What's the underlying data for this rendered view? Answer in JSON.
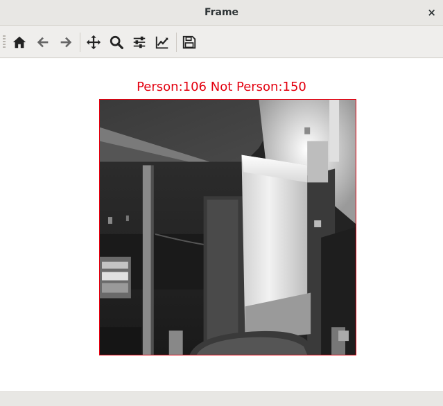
{
  "window": {
    "title": "Frame",
    "close_symbol": "×"
  },
  "toolbar": {
    "buttons": [
      {
        "name": "home-button",
        "icon": "home-icon"
      },
      {
        "name": "back-button",
        "icon": "arrow-left-icon"
      },
      {
        "name": "forward-button",
        "icon": "arrow-right-icon"
      },
      {
        "name": "pan-button",
        "icon": "move-icon"
      },
      {
        "name": "zoom-button",
        "icon": "magnifier-icon"
      },
      {
        "name": "configure-subplots-button",
        "icon": "sliders-icon"
      },
      {
        "name": "edit-axes-button",
        "icon": "line-chart-icon"
      },
      {
        "name": "save-button",
        "icon": "floppy-disk-icon"
      }
    ]
  },
  "plot": {
    "title": "Person:106 Not Person:150",
    "title_color": "#e3000f",
    "frame_color": "#e3000f"
  }
}
